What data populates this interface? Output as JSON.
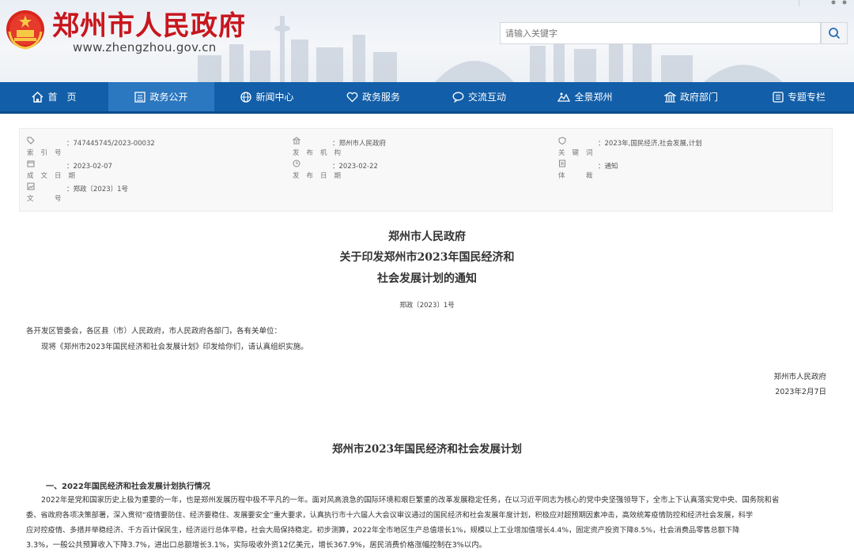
{
  "header": {
    "site_title": "郑州市人民政府",
    "site_url": "www.zhengzhou.gov.cn",
    "search_placeholder": "请输入关键字",
    "brand_color": "#c8161d"
  },
  "nav": {
    "color": "#125ea8",
    "items": [
      {
        "label": "首　页",
        "icon": "home-icon"
      },
      {
        "label": "政务公开",
        "icon": "document-icon",
        "active": true
      },
      {
        "label": "新闻中心",
        "icon": "globe-icon"
      },
      {
        "label": "政务服务",
        "icon": "heart-icon"
      },
      {
        "label": "交流互动",
        "icon": "chat-icon"
      },
      {
        "label": "全景郑州",
        "icon": "panorama-icon"
      },
      {
        "label": "政府部门",
        "icon": "building-icon"
      },
      {
        "label": "专题专栏",
        "icon": "column-icon"
      }
    ]
  },
  "meta": {
    "index_label": "索引号",
    "index_value": "：747445745/2023-00032",
    "publisher_label": "发布机构",
    "publisher_value": "：郑州市人民政府",
    "keywords_label": "关键词",
    "keywords_value": "：2023年,国民经济,社会发展,计划",
    "created_label": "成文日期",
    "created_value": "：2023-02-07",
    "published_label": "发布日期",
    "published_value": "：2023-02-22",
    "genre_label": "体　裁",
    "genre_value": "：通知",
    "docno_label": "文　号",
    "docno_value": "：郑政〔2023〕1号"
  },
  "document": {
    "title_line1": "郑州市人民政府",
    "title_line2": "关于印发郑州市2023年国民经济和",
    "title_line3": "社会发展计划的通知",
    "doc_number": "郑政〔2023〕1号",
    "salutation": "各开发区管委会，各区县（市）人民政府，市人民政府各部门，各有关单位：",
    "body": "现将《郑州市2023年国民经济和社会发展计划》印发给你们，请认真组织实施。",
    "signature": "郑州市人民政府",
    "date": "2023年2月7日",
    "plan_title": "郑州市2023年国民经济和社会发展计划",
    "section1_heading": "一、2022年国民经济和社会发展计划执行情况",
    "para_line1": "2022年是党和国家历史上极为重要的一年，也是郑州发展历程中极不平凡的一年。面对风高浪急的国际环境和艰巨繁重的改革发展稳定任务，在以习近平同志为核心的党中央坚强领导下，全市上下认真落实党中央、国务院和省",
    "para_line2": "委、省政府各项决策部署，深入贯彻“疫情要防住、经济要稳住、发展要安全”重大要求，认真执行市十六届人大会议审议通过的国民经济和社会发展年度计划，积极应对超预期因素冲击，高效统筹疫情防控和经济社会发展，科学",
    "para_line3": "应对控疫情、多措并举稳经济、千方百计保民生，经济运行总体平稳，社会大局保持稳定。初步测算，2022年全市地区生产总值增长1%，规模以上工业增加值增长4.4%，固定资产投资下降8.5%，社会消费品零售总额下降",
    "para_line4": "3.3%，一般公共预算收入下降3.7%，进出口总额增长3.1%，实际吸收外资12亿美元，增长367.9%，居民消费价格涨幅控制在3%以内。"
  }
}
